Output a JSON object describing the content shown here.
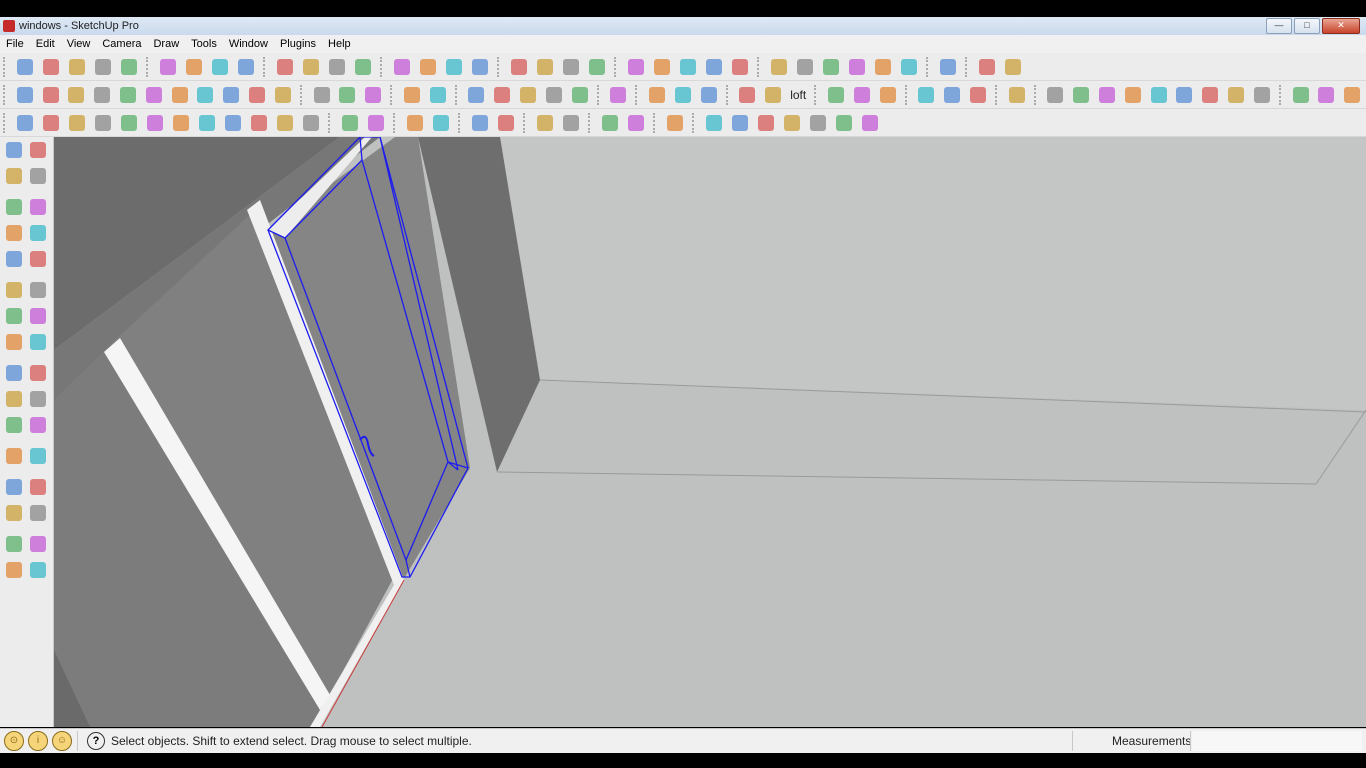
{
  "window": {
    "title": "windows - SketchUp Pro"
  },
  "menu": [
    "File",
    "Edit",
    "View",
    "Camera",
    "Draw",
    "Tools",
    "Window",
    "Plugins",
    "Help"
  ],
  "toolbar": {
    "row1": [
      "select-icon",
      "pencil-icon",
      "rectangle-icon",
      "circle-icon",
      "arc-icon",
      "component-icon",
      "eraser-icon",
      "tape-measure-icon",
      "paint-bucket-icon",
      "push-pull-icon",
      "move-icon",
      "rotate-icon",
      "follow-me-icon",
      "orbit-icon",
      "pan-icon",
      "zoom-icon",
      "zoom-extents-icon",
      "warehouse-icon",
      "share-model-icon",
      "extension-icon",
      "shadow-icon",
      "style-icon",
      "iso-view-icon",
      "top-view-icon",
      "front-view-icon",
      "right-view-icon",
      "section-plane-icon",
      "section-cut-icon",
      "solid-union-icon",
      "solid-subtract-icon",
      "solid-trim-icon",
      "solid-split-icon",
      "tag-icon",
      "geo-location-icon",
      "sandbox-icon"
    ],
    "row2": [
      "stairs-icon",
      "profile-icon",
      "extrude-icon",
      "curve-icon",
      "bezier-icon",
      "frame-icon",
      "arch-icon",
      "roof-icon",
      "fillet-icon",
      "chamfer-icon",
      "weld-icon",
      "section-icon",
      "lathe-icon",
      "star-icon",
      "measure-icon",
      "texture-icon",
      "sphere-icon",
      "cone-icon",
      "torus-icon",
      "dome-icon",
      "hand-icon",
      "lock-icon",
      "box-icon",
      "box-alt-icon",
      "cylinder-icon",
      "loop-icon",
      "bridge-icon",
      "loft-text",
      "drop-icon",
      "drop2-icon",
      "anchor-icon",
      "rotate-axis-icon",
      "shift-icon",
      "leaf-icon",
      "pen-icon",
      "shape1-icon",
      "shape2-icon",
      "shape3-icon",
      "shape4-icon",
      "shape5-icon",
      "shape6-icon",
      "shape7-icon",
      "shape8-icon",
      "curve-tool-icon",
      "gear-icon",
      "ruler-icon",
      "erase-tool-icon"
    ],
    "row3": [
      "m-badge-icon",
      "tag-yellow-icon",
      "r-badge-icon",
      "question-badge-icon",
      "label-icon",
      "dot-icon",
      "hat-icon",
      "flag-icon",
      "spark-icon",
      "ball-icon",
      "wasp-icon",
      "shell-icon",
      "lock-open-icon",
      "bucket-icon",
      "align-icon",
      "pipe-icon",
      "arrow-up-down-icon",
      "arrows-red-icon",
      "diag-icon",
      "flip-icon",
      "undo-blue-icon",
      "redo-red-icon",
      "door-icon",
      "target-icon",
      "gear2-icon",
      "gear3-icon",
      "flower-icon",
      "paper-icon",
      "fold-icon",
      "close-red-icon"
    ],
    "loft_label": "loft"
  },
  "left_tools": [
    [
      "select-icon",
      "component-icon"
    ],
    [
      "paint-bucket-icon",
      "eraser-icon"
    ],
    [
      "rectangle-icon",
      "pencil-icon"
    ],
    [
      "circle-icon",
      "arc-icon"
    ],
    [
      "polygon-icon",
      "freehand-icon"
    ],
    [
      "move-icon",
      "push-pull-icon"
    ],
    [
      "rotate-icon",
      "follow-me-icon"
    ],
    [
      "scale-icon",
      "offset-icon"
    ],
    [
      "tape-measure-icon",
      "dimension-icon"
    ],
    [
      "protractor-icon",
      "text-icon"
    ],
    [
      "axes-icon",
      "3d-text-icon"
    ],
    [
      "orbit-icon",
      "pan-icon"
    ],
    [
      "zoom-icon",
      "zoom-window-icon"
    ],
    [
      "previous-view-icon",
      "next-view-icon"
    ],
    [
      "position-camera-icon",
      "look-around-icon"
    ],
    [
      "walk-icon",
      "section-plane-icon"
    ]
  ],
  "status": {
    "message": "Select objects. Shift to extend select. Drag mouse to select multiple.",
    "measurements_label": "Measurements",
    "measurements_value": ""
  },
  "colors": {
    "selection": "#1c1cf0",
    "viewport_bg": "#bfc0c0"
  }
}
